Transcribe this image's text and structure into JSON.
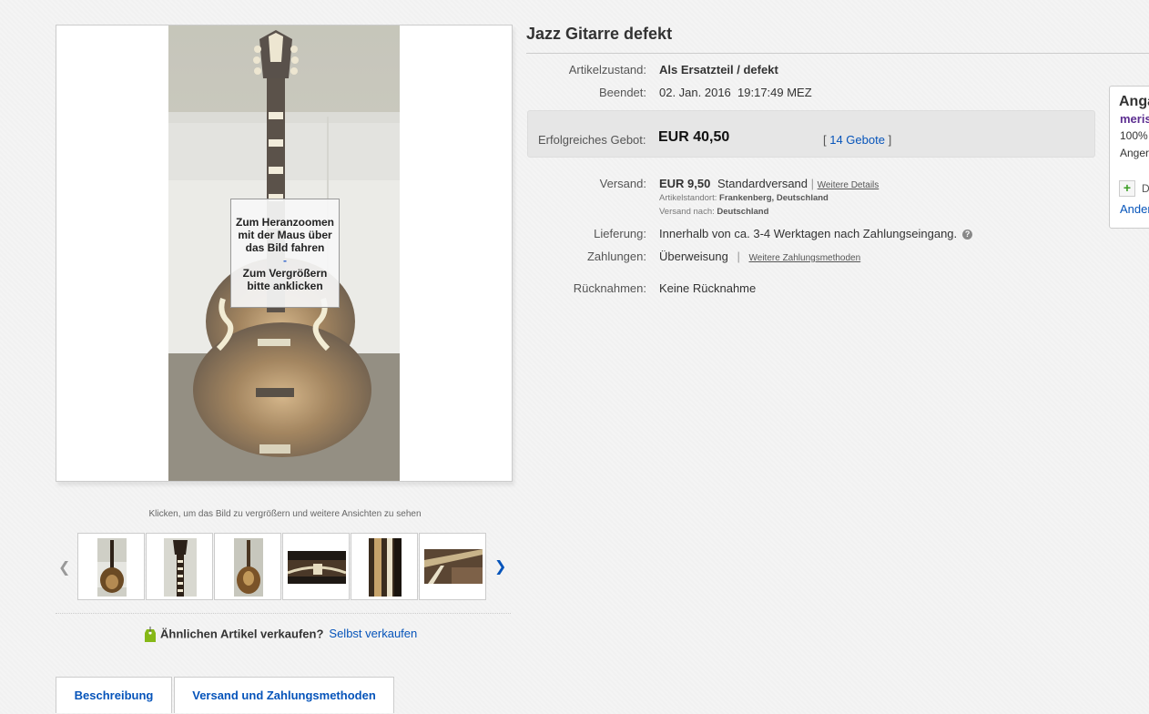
{
  "image": {
    "zoom_hint_line1": "Zum Heranzoomen mit der Maus über das Bild fahren",
    "zoom_hint_sep": "-",
    "zoom_hint_line2": "Zum Vergrößern bitte anklicken",
    "caption": "Klicken, um das Bild zu vergrößern und weitere Ansichten zu sehen"
  },
  "thumbnails": {
    "prev_icon": "chevron-left-icon",
    "next_icon": "chevron-right-icon",
    "count": 6
  },
  "sell_similar": {
    "question": "Ähnlichen Artikel verkaufen?",
    "link": "Selbst verkaufen"
  },
  "tabs": [
    {
      "label": "Beschreibung"
    },
    {
      "label": "Versand und Zahlungsmethoden"
    }
  ],
  "item": {
    "title": "Jazz Gitarre defekt",
    "condition_label": "Artikelzustand:",
    "condition_value": "Als Ersatzteil / defekt",
    "ended_label": "Beendet:",
    "ended_value": "02. Jan. 2016  19:17:49 MEZ",
    "bid_label": "Erfolgreiches Gebot:",
    "bid_price": "EUR 40,50",
    "bid_open": "[ ",
    "bid_count": "14 Gebote",
    "bid_close": " ]",
    "shipping_label": "Versand:",
    "shipping_price": "EUR 9,50",
    "shipping_service": "Standardversand",
    "shipping_sep": "|",
    "shipping_details_link": "Weitere Details",
    "location_label": "Artikelstandort:",
    "location_value": "Frankenberg, Deutschland",
    "ships_to_label": "Versand nach:",
    "ships_to_value": "Deutschland",
    "delivery_label": "Lieferung:",
    "delivery_value": "Innerhalb von ca. 3-4 Werktagen nach Zahlungseingang.",
    "delivery_help": "?",
    "payment_label": "Zahlungen:",
    "payment_value": "Überweisung",
    "payment_sep": "|",
    "payment_more_link": "Weitere Zahlungsmethoden",
    "returns_label": "Rücknahmen:",
    "returns_value": "Keine Rücknahme"
  },
  "seller": {
    "title": "Anga",
    "name": "meris",
    "rating": "100%",
    "since": "Anger",
    "add_icon": "+",
    "add_label": "D",
    "other_link": "Ander"
  },
  "colors": {
    "link": "#0654ba",
    "seller_name": "#5d2f91",
    "bid_box": "#e6e6e6"
  }
}
